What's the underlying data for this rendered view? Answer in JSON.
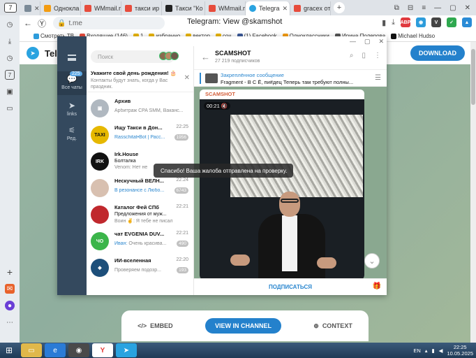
{
  "browser": {
    "tab_count": "7",
    "tabs": [
      {
        "label": "",
        "color": "#7b8a97"
      },
      {
        "label": "Однокла",
        "color": "#f39c12"
      },
      {
        "label": "WMmail.r",
        "color": "#e74c3c"
      },
      {
        "label": "такси ир",
        "color": "#e74c3c"
      },
      {
        "label": "Такси \"Ко",
        "color": "#222222"
      },
      {
        "label": "WMmail.r",
        "color": "#e74c3c"
      },
      {
        "label": "Telegra",
        "color": "#2aa3e0"
      },
      {
        "label": "gracex от",
        "color": "#e74c3c"
      }
    ],
    "url": "t.me",
    "page_title": "Telegram: View @skamshot",
    "bookmarks": [
      "Смотреть ТВ",
      "Входящие (146)",
      "1",
      "избранно",
      "вектор",
      "coч",
      "(1) Facebook",
      "Одноклассники",
      "Ирина Полерова",
      "Michael Hudso"
    ]
  },
  "site": {
    "brand": "Teleg",
    "download_label": "DOWNLOAD",
    "embed_label": "EMBED",
    "view_channel_label": "VIEW IN CHANNEL",
    "context_label": "CONTEXT"
  },
  "telegram": {
    "rail": {
      "all_chats_label": "Все чаты",
      "all_chats_count": "225",
      "links_label": "links",
      "edit_label": "Ред."
    },
    "search_placeholder": "Поиск",
    "birthday": {
      "title": "Укажите свой день рождения! 🎂",
      "text": "Контакты будут знать, когда у Вас праздник."
    },
    "chats": [
      {
        "name": "Архив",
        "time": "",
        "preview_sender": "",
        "preview": "Арбитраж CPA SMM, Ваканс...",
        "badge": "",
        "color": "#b0b8c0",
        "initials": "▣"
      },
      {
        "name": "Ищу Такси в Дон...",
        "time": "22:25",
        "preview_sender": "Rasschitat•Bot | Расс...",
        "preview": "",
        "badge": "1956",
        "color": "#e6b800",
        "initials": "TAXI"
      },
      {
        "name": "Irk.House",
        "time": "",
        "preview_sender": "",
        "preview": "Болталка",
        "badge": "",
        "color": "#111111",
        "initials": "IRK"
      },
      {
        "name": "Нескучный ВЕЛН...",
        "time": "22:24",
        "preview_sender": "В резонансе с Любо...",
        "preview": "",
        "badge": "6743",
        "color": "#d8c0b0",
        "initials": ""
      },
      {
        "name": "Каталог Фей СПб",
        "time": "22:21",
        "preview_sender": "",
        "preview": "Предложения от муж...",
        "badge": "",
        "color": "#c0282d",
        "initials": ""
      },
      {
        "name": "чат EVGENIA DUV...",
        "time": "22:21",
        "preview_sender": "Иван:",
        "preview": "Очень красива...",
        "badge": "490",
        "color": "#3bb54a",
        "initials": "ЧО"
      },
      {
        "name": "ИИ-вселенная",
        "time": "22:20",
        "preview_sender": "",
        "preview": "Проверяем подозр...",
        "badge": "193",
        "color": "#1d4f7a",
        "initials": ""
      }
    ],
    "venom_line": "Venom: Нет не",
    "voin_line": "Воин ✌: Я тебе не писал ...",
    "channel": {
      "title": "SCAMSHOT",
      "subscribers": "27 219 подписчиков",
      "pinned_title": "Закреплённое сообщение",
      "pinned_text": "Fragment - В С Ё, пи#дец  Теперь там требуют полны...",
      "author": "SCAMSHOT",
      "duration": "00:21",
      "subscribe_label": "ПОДПИСАТЬСЯ"
    },
    "toast": "Спасибо! Ваша жалоба отправлена на проверку."
  },
  "taskbar": {
    "lang": "EN",
    "time": "22:25",
    "date": "10.05.2025"
  }
}
